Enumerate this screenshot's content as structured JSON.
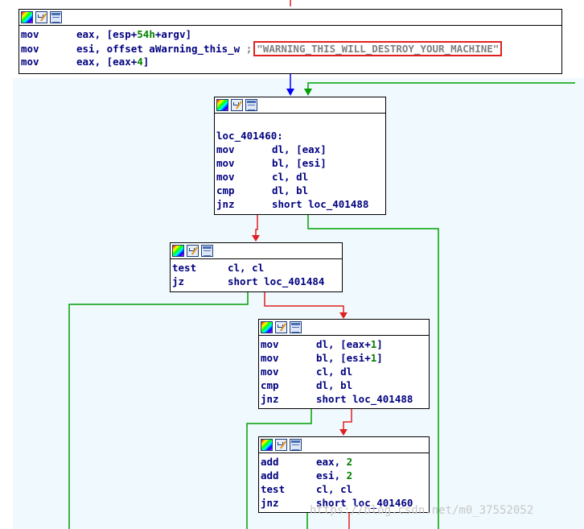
{
  "blocks": {
    "b0": {
      "rows": [
        {
          "mn": "mov",
          "op": "eax, [esp+54h+argv]"
        },
        {
          "mn": "mov",
          "op": "esi, offset aWarning_this_w",
          "comment": ";",
          "string": "\"WARNING_THIS_WILL_DESTROY_YOUR_MACHINE\""
        },
        {
          "mn": "mov",
          "op": "eax, [eax+4]"
        }
      ]
    },
    "b1": {
      "label": "loc_401460:",
      "rows": [
        {
          "mn": "mov",
          "op": "dl, [eax]"
        },
        {
          "mn": "mov",
          "op": "bl, [esi]"
        },
        {
          "mn": "mov",
          "op": "cl, dl"
        },
        {
          "mn": "cmp",
          "op": "dl, bl"
        },
        {
          "mn": "jnz",
          "op": "short loc_401488"
        }
      ]
    },
    "b2": {
      "rows": [
        {
          "mn": "test",
          "op": "cl, cl"
        },
        {
          "mn": "jz",
          "op": "short loc_401484"
        }
      ]
    },
    "b3": {
      "rows": [
        {
          "mn": "mov",
          "op": "dl, [eax+1]"
        },
        {
          "mn": "mov",
          "op": "bl, [esi+1]"
        },
        {
          "mn": "mov",
          "op": "cl, dl"
        },
        {
          "mn": "cmp",
          "op": "dl, bl"
        },
        {
          "mn": "jnz",
          "op": "short loc_401488"
        }
      ]
    },
    "b4": {
      "rows": [
        {
          "mn": "add",
          "op": "eax, 2"
        },
        {
          "mn": "add",
          "op": "esi, 2"
        },
        {
          "mn": "test",
          "op": "cl, cl"
        },
        {
          "mn": "jnz",
          "op": "short loc_401460"
        }
      ]
    }
  },
  "watermark": "https://blog.csdn.net/m0_37552052",
  "colors": {
    "edge_true": "#00a000",
    "edge_false": "#e02020",
    "edge_unconditional": "#0000ff",
    "graph_background": "#f0f9fe",
    "string_highlight": "#e02020",
    "code_text": "#000080"
  },
  "icons": [
    "color-palette-icon",
    "rename-pencil-icon",
    "graph-view-icon"
  ]
}
